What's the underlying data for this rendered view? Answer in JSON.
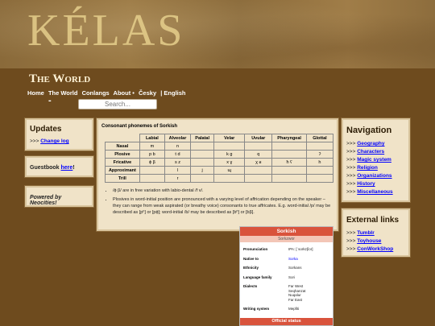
{
  "banner": {
    "logo": "KÉLAS"
  },
  "site_title": "The World",
  "topnav": [
    "Home",
    "The World",
    "Conlangs",
    "About •",
    "Česky",
    "| English"
  ],
  "dash": "-",
  "search": {
    "placeholder": "Search..."
  },
  "updates": {
    "title": "Updates",
    "prefix": ">>> ",
    "link": "Change log"
  },
  "guestbook": {
    "text": "Guestbook ",
    "link": "here",
    "suffix": "!"
  },
  "neocities": {
    "text": "Powered by Neocities!"
  },
  "main": {
    "title": "Consonant phonemes of Sorkish",
    "columns": [
      "Labial",
      "Alveolar",
      "Palatal",
      "Velar",
      "Uvular",
      "Pharyngeal",
      "Glottal"
    ],
    "rows": [
      {
        "label": "Nasal",
        "cells": [
          "m",
          "n",
          "",
          "",
          "",
          "",
          ""
        ]
      },
      {
        "label": "Plosive",
        "cells": [
          "p b",
          "t d",
          "",
          "k g",
          "q",
          "",
          "ʔ"
        ]
      },
      {
        "label": "Fricative",
        "cells": [
          "ɸ β",
          "s z",
          "",
          "x ɣ",
          "χ ʁ",
          "ħ ʕ",
          "h"
        ]
      },
      {
        "label": "Approximant",
        "cells": [
          "",
          "l",
          "j",
          "ɰ",
          "",
          "",
          ""
        ]
      },
      {
        "label": "Trill",
        "cells": [
          "",
          "r",
          "",
          "",
          "",
          "",
          ""
        ]
      }
    ],
    "notes": [
      "/ɸ β/ are in free variation with labio-dental /f v/.",
      "Plosives in word-initial position are pronounced with a varying level of affrication depending on the speaker – they can range from weak aspirated (or breathy voice) consonants to true affricates. E.g. word-initial /p/ may be described as [pʰ] or [pɸ]; word-initial /b/ may be described as [bʱ] or [bβ]."
    ]
  },
  "navigation": {
    "title": "Navigation",
    "prefix": ">>> ",
    "items": [
      "Geography",
      "Characters",
      "Magic system",
      "Religion",
      "Organizations",
      "History",
      "Miscellaneous"
    ]
  },
  "external": {
    "title": "External links",
    "prefix": ">>> ",
    "items": [
      "Tumblr",
      "Toyhouse",
      "ConWorkShop"
    ]
  },
  "infobox": {
    "title": "Sorkish",
    "subtitle": "Sorkzwor",
    "rows": [
      {
        "key": "Pronunciation",
        "value": "IPA: [ˈsorkzβɔr]"
      },
      {
        "key": "Native to",
        "value": "Sorka"
      },
      {
        "key": "Ethnicity",
        "value": "Sorkans"
      },
      {
        "key": "Language family",
        "value": "Sori"
      },
      {
        "key": "Dialects",
        "value": "Far West\nSeqhanzat\nNuqalur\nFar East"
      },
      {
        "key": "Writing system",
        "value": "Mepfiti"
      }
    ],
    "footer": "Official status"
  }
}
